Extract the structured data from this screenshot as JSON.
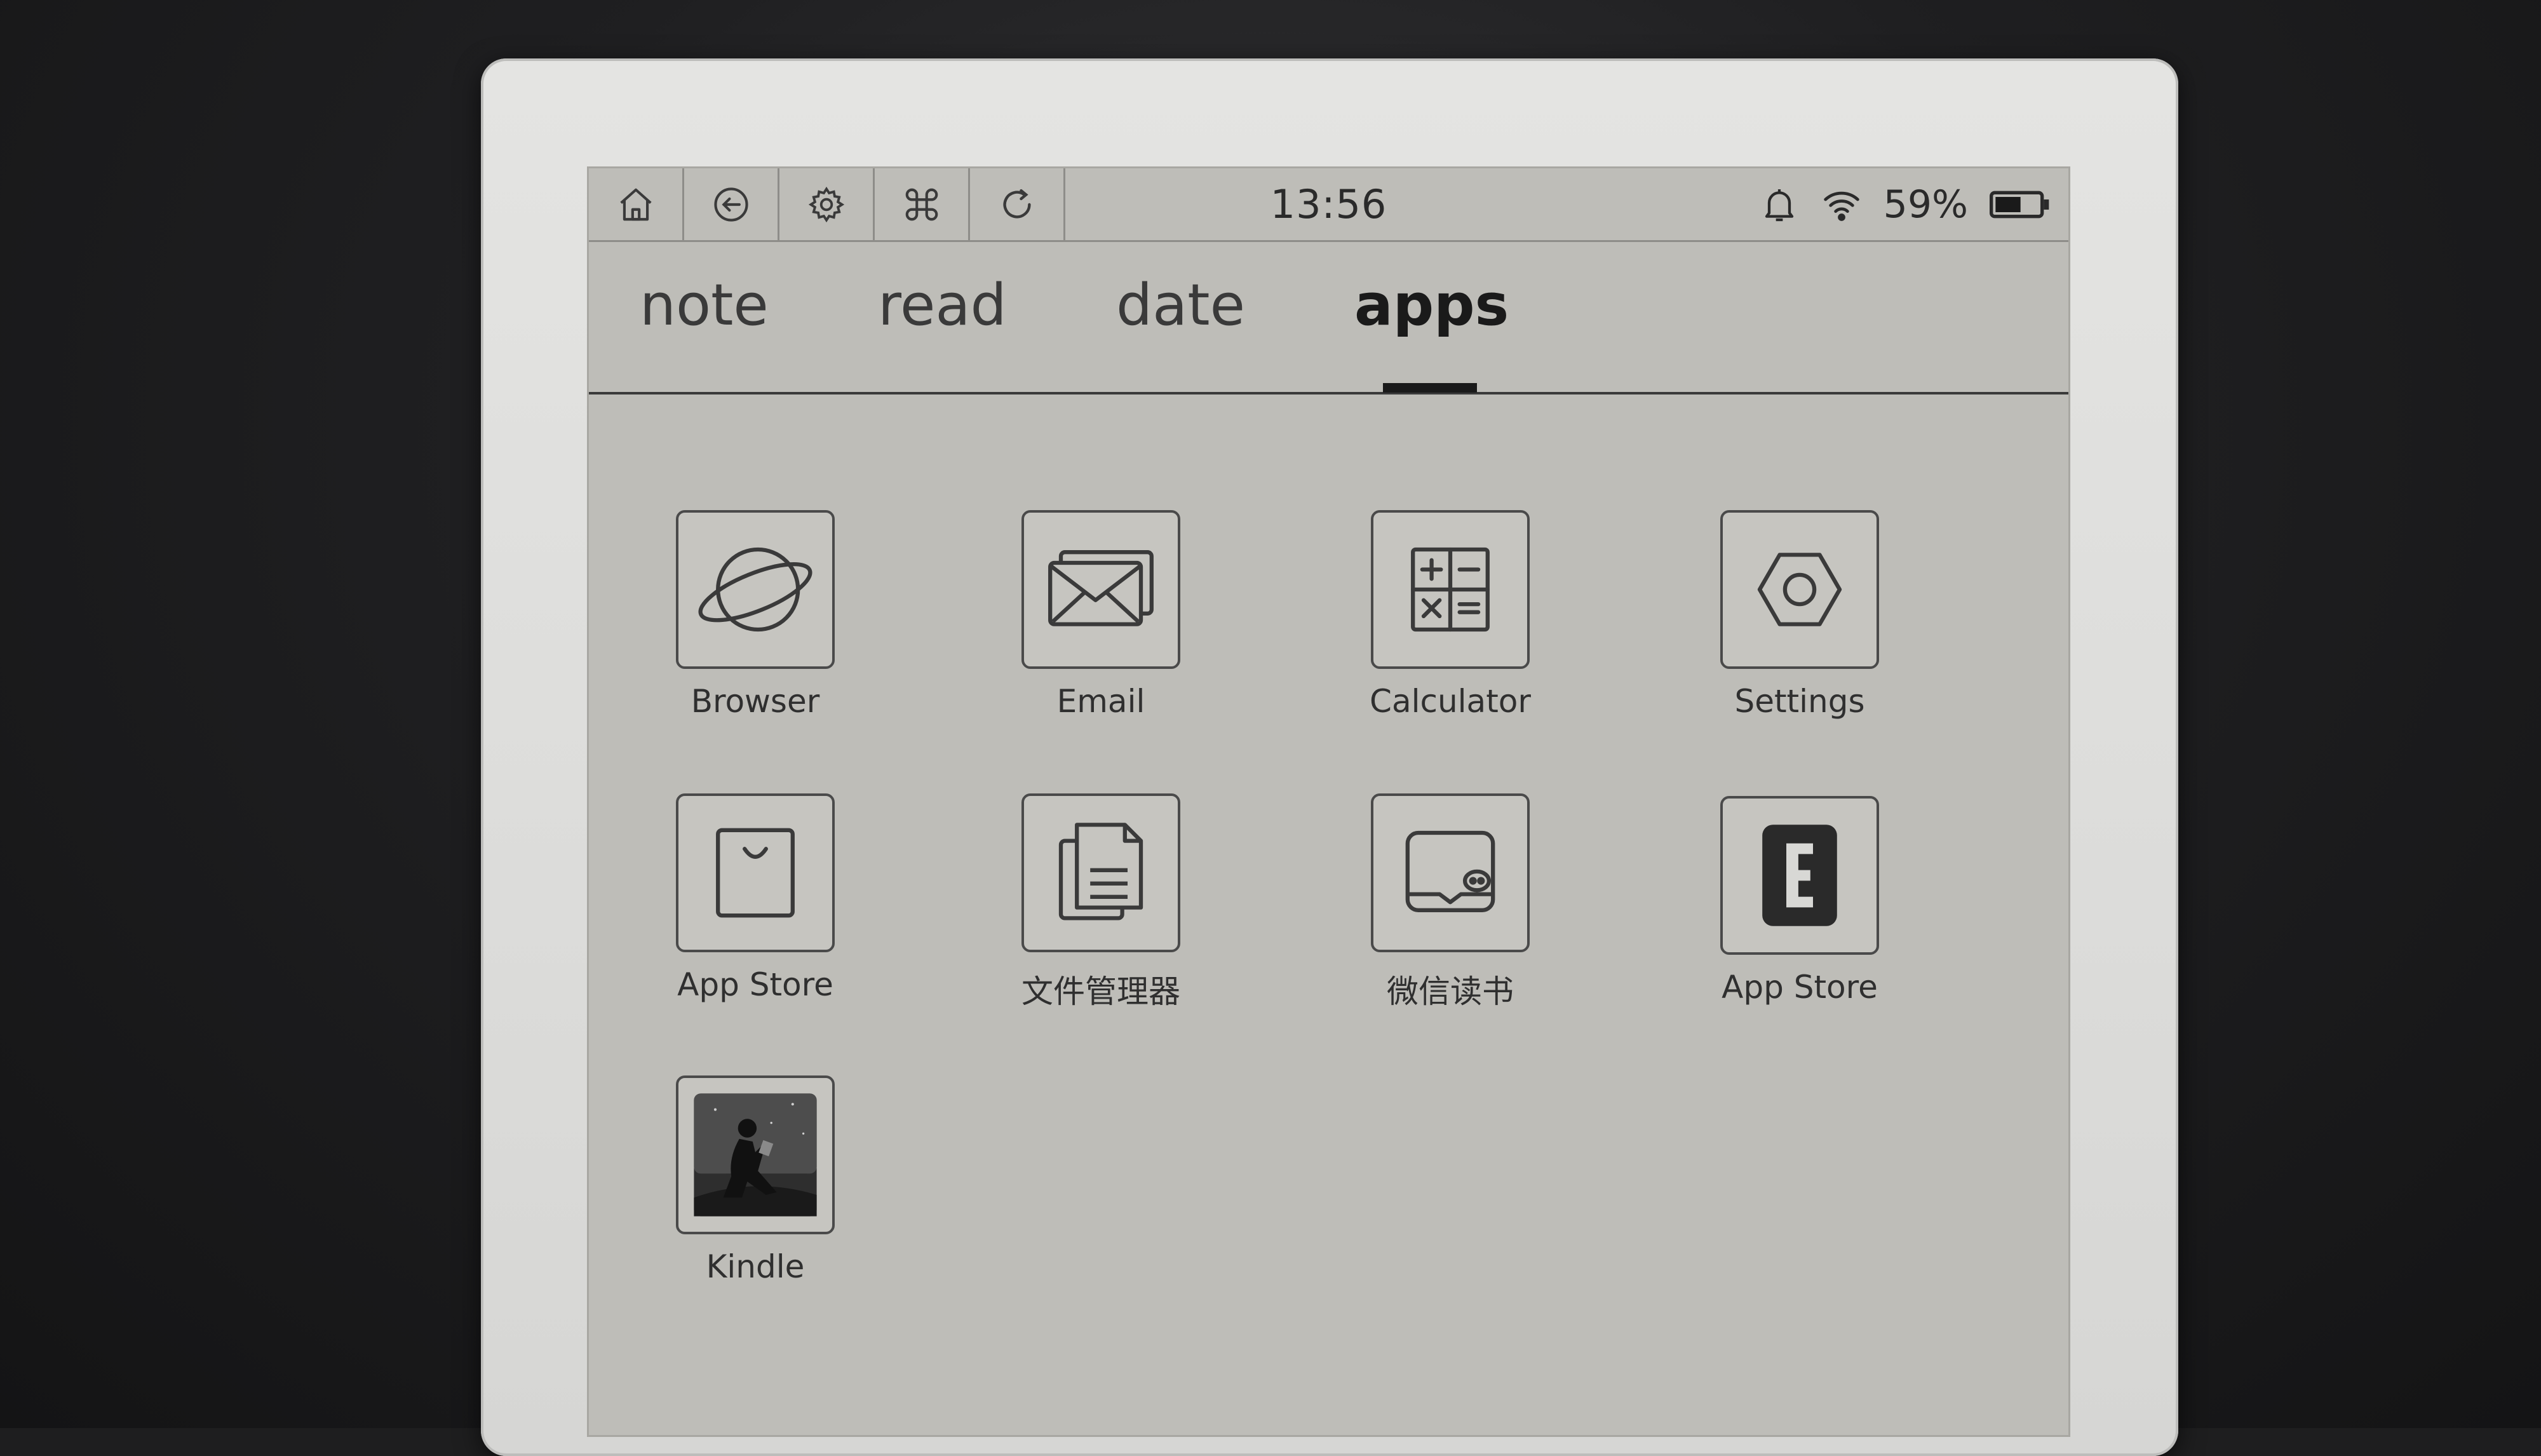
{
  "status_bar": {
    "buttons": [
      {
        "icon": "home-icon"
      },
      {
        "icon": "back-icon"
      },
      {
        "icon": "gear-icon"
      },
      {
        "icon": "command-icon"
      },
      {
        "icon": "refresh-icon"
      }
    ],
    "time": "13:56",
    "battery_percent": "59%",
    "battery_level": 0.59,
    "indicators": [
      "bell-icon",
      "wifi-icon",
      "battery-icon"
    ]
  },
  "tabs": [
    {
      "label": "note",
      "active": false
    },
    {
      "label": "read",
      "active": false
    },
    {
      "label": "date",
      "active": false
    },
    {
      "label": "apps",
      "active": true
    }
  ],
  "apps": [
    {
      "label": "Browser",
      "icon": "browser-globe-icon"
    },
    {
      "label": "Email",
      "icon": "email-icon"
    },
    {
      "label": "Calculator",
      "icon": "calculator-icon"
    },
    {
      "label": "Settings",
      "icon": "settings-hexagon-icon"
    },
    {
      "label": "App Store",
      "icon": "app-store-bag-icon"
    },
    {
      "label": "文件管理器",
      "icon": "file-manager-icon"
    },
    {
      "label": "微信读书",
      "icon": "wechat-read-icon"
    },
    {
      "label": "App Store",
      "icon": "app-store-e-icon"
    },
    {
      "label": "Kindle",
      "icon": "kindle-reader-icon"
    }
  ]
}
